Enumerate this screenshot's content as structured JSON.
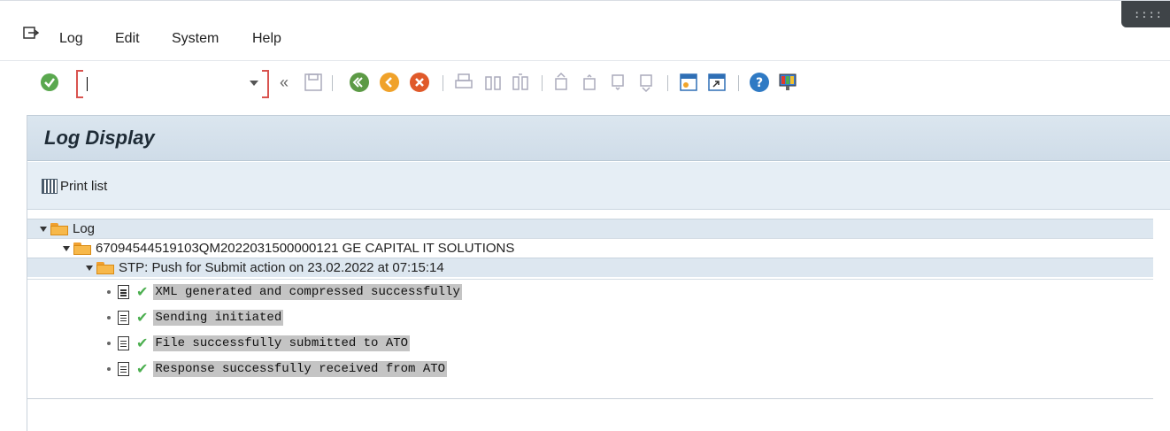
{
  "menu": {
    "items": [
      {
        "label": "Log"
      },
      {
        "label": "Edit"
      },
      {
        "label": "System"
      },
      {
        "label": "Help"
      }
    ]
  },
  "toolbar": {
    "command_value": "",
    "command_placeholder": "",
    "icons": [
      "enter-check-icon",
      "save-icon",
      "back-icon",
      "exit-icon",
      "cancel-icon",
      "print-icon",
      "find-icon",
      "find-next-icon",
      "first-page-icon",
      "previous-page-icon",
      "next-page-icon",
      "last-page-icon",
      "create-session-icon",
      "shortcut-icon",
      "help-icon",
      "customize-layout-icon"
    ]
  },
  "page": {
    "title": "Log Display",
    "print_label": "Print list"
  },
  "tree": {
    "root": "Log",
    "level1": "67094544519103QM2022031500000121 GE CAPITAL IT SOLUTIONS",
    "level2": "STP: Push for Submit action on 23.02.2022 at 07:15:14",
    "messages": [
      "XML generated and compressed successfully",
      "Sending initiated",
      "File successfully submitted to ATO",
      "Response successfully received from ATO"
    ]
  },
  "colors": {
    "accent": "#4caf50",
    "folder": "#f7b84a",
    "title_bg": "#dbe6ef",
    "required_field": "#d9534f"
  }
}
